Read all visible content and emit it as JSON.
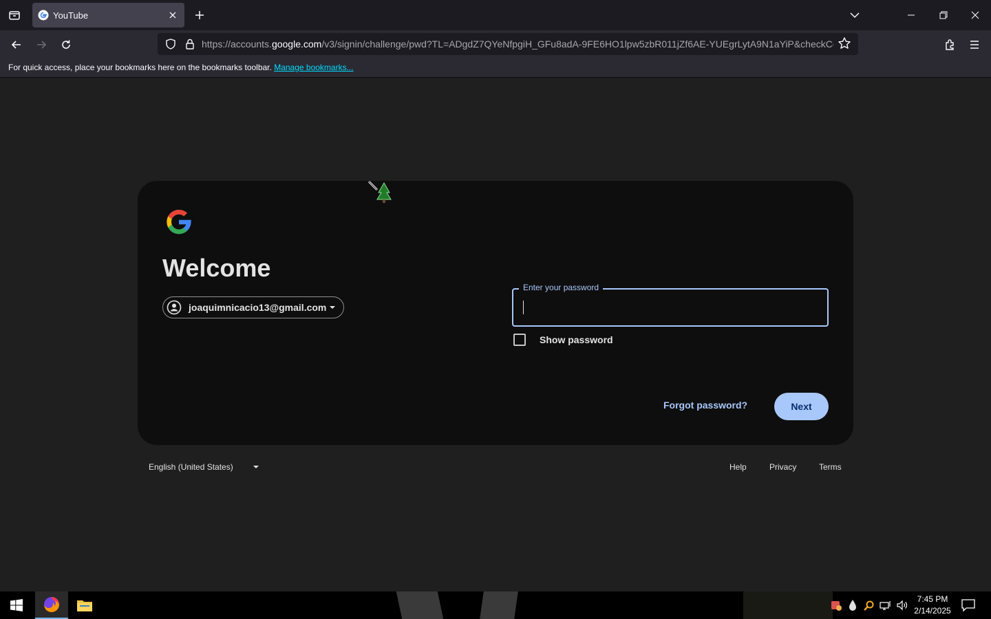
{
  "browser": {
    "tab_title": "YouTube",
    "url_prefix": "https://accounts.",
    "url_domain": "google.com",
    "url_rest": "/v3/signin/challenge/pwd?TL=ADgdZ7QYeNfpgiH_GFu8adA-9FE6HO1lpw5zbR011jZf6AE-YUEgrLytA9N1aYiP&checkConne",
    "bookmarks_text": "For quick access, place your bookmarks here on the bookmarks toolbar.",
    "bookmarks_link": "Manage bookmarks..."
  },
  "signin": {
    "heading": "Welcome",
    "account_email": "joaquimnicacio13@gmail.com",
    "password_label": "Enter your password",
    "password_value": "",
    "show_password_label": "Show password",
    "forgot_label": "Forgot password?",
    "next_label": "Next"
  },
  "footer": {
    "language": "English (United States)",
    "help": "Help",
    "privacy": "Privacy",
    "terms": "Terms"
  },
  "taskbar": {
    "time": "7:45 PM",
    "date": "2/14/2025"
  },
  "colors": {
    "accent": "#a8c7fa",
    "card_bg": "#0e0e0e",
    "page_bg": "#1f1f1f"
  }
}
